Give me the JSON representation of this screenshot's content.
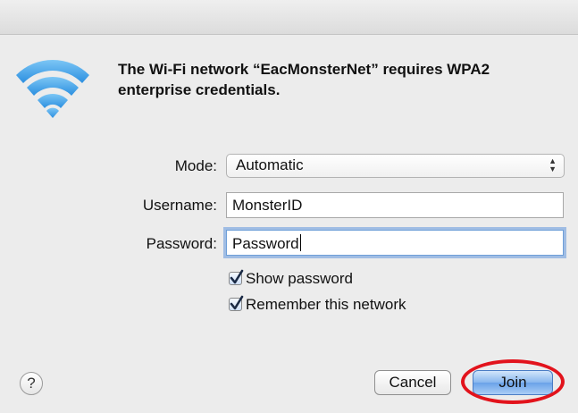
{
  "dialog": {
    "message": "The Wi-Fi network “EacMonsterNet” requires WPA2 enterprise credentials."
  },
  "form": {
    "mode_label": "Mode:",
    "mode_value": "Automatic",
    "username_label": "Username:",
    "username_value": "MonsterID",
    "password_label": "Password:",
    "password_value": "Password",
    "show_password_label": "Show password",
    "show_password_checked": true,
    "remember_label": "Remember this network",
    "remember_checked": true
  },
  "buttons": {
    "help_label": "?",
    "cancel_label": "Cancel",
    "join_label": "Join"
  },
  "colors": {
    "wifi_icon": "#3b9ee8",
    "highlight_ring": "#e2131c",
    "default_button": "#6aa2e8",
    "focus_ring": "#6398de"
  },
  "icons": [
    "wifi-icon",
    "select-arrows-icon",
    "checkmark-icon",
    "help-icon"
  ]
}
